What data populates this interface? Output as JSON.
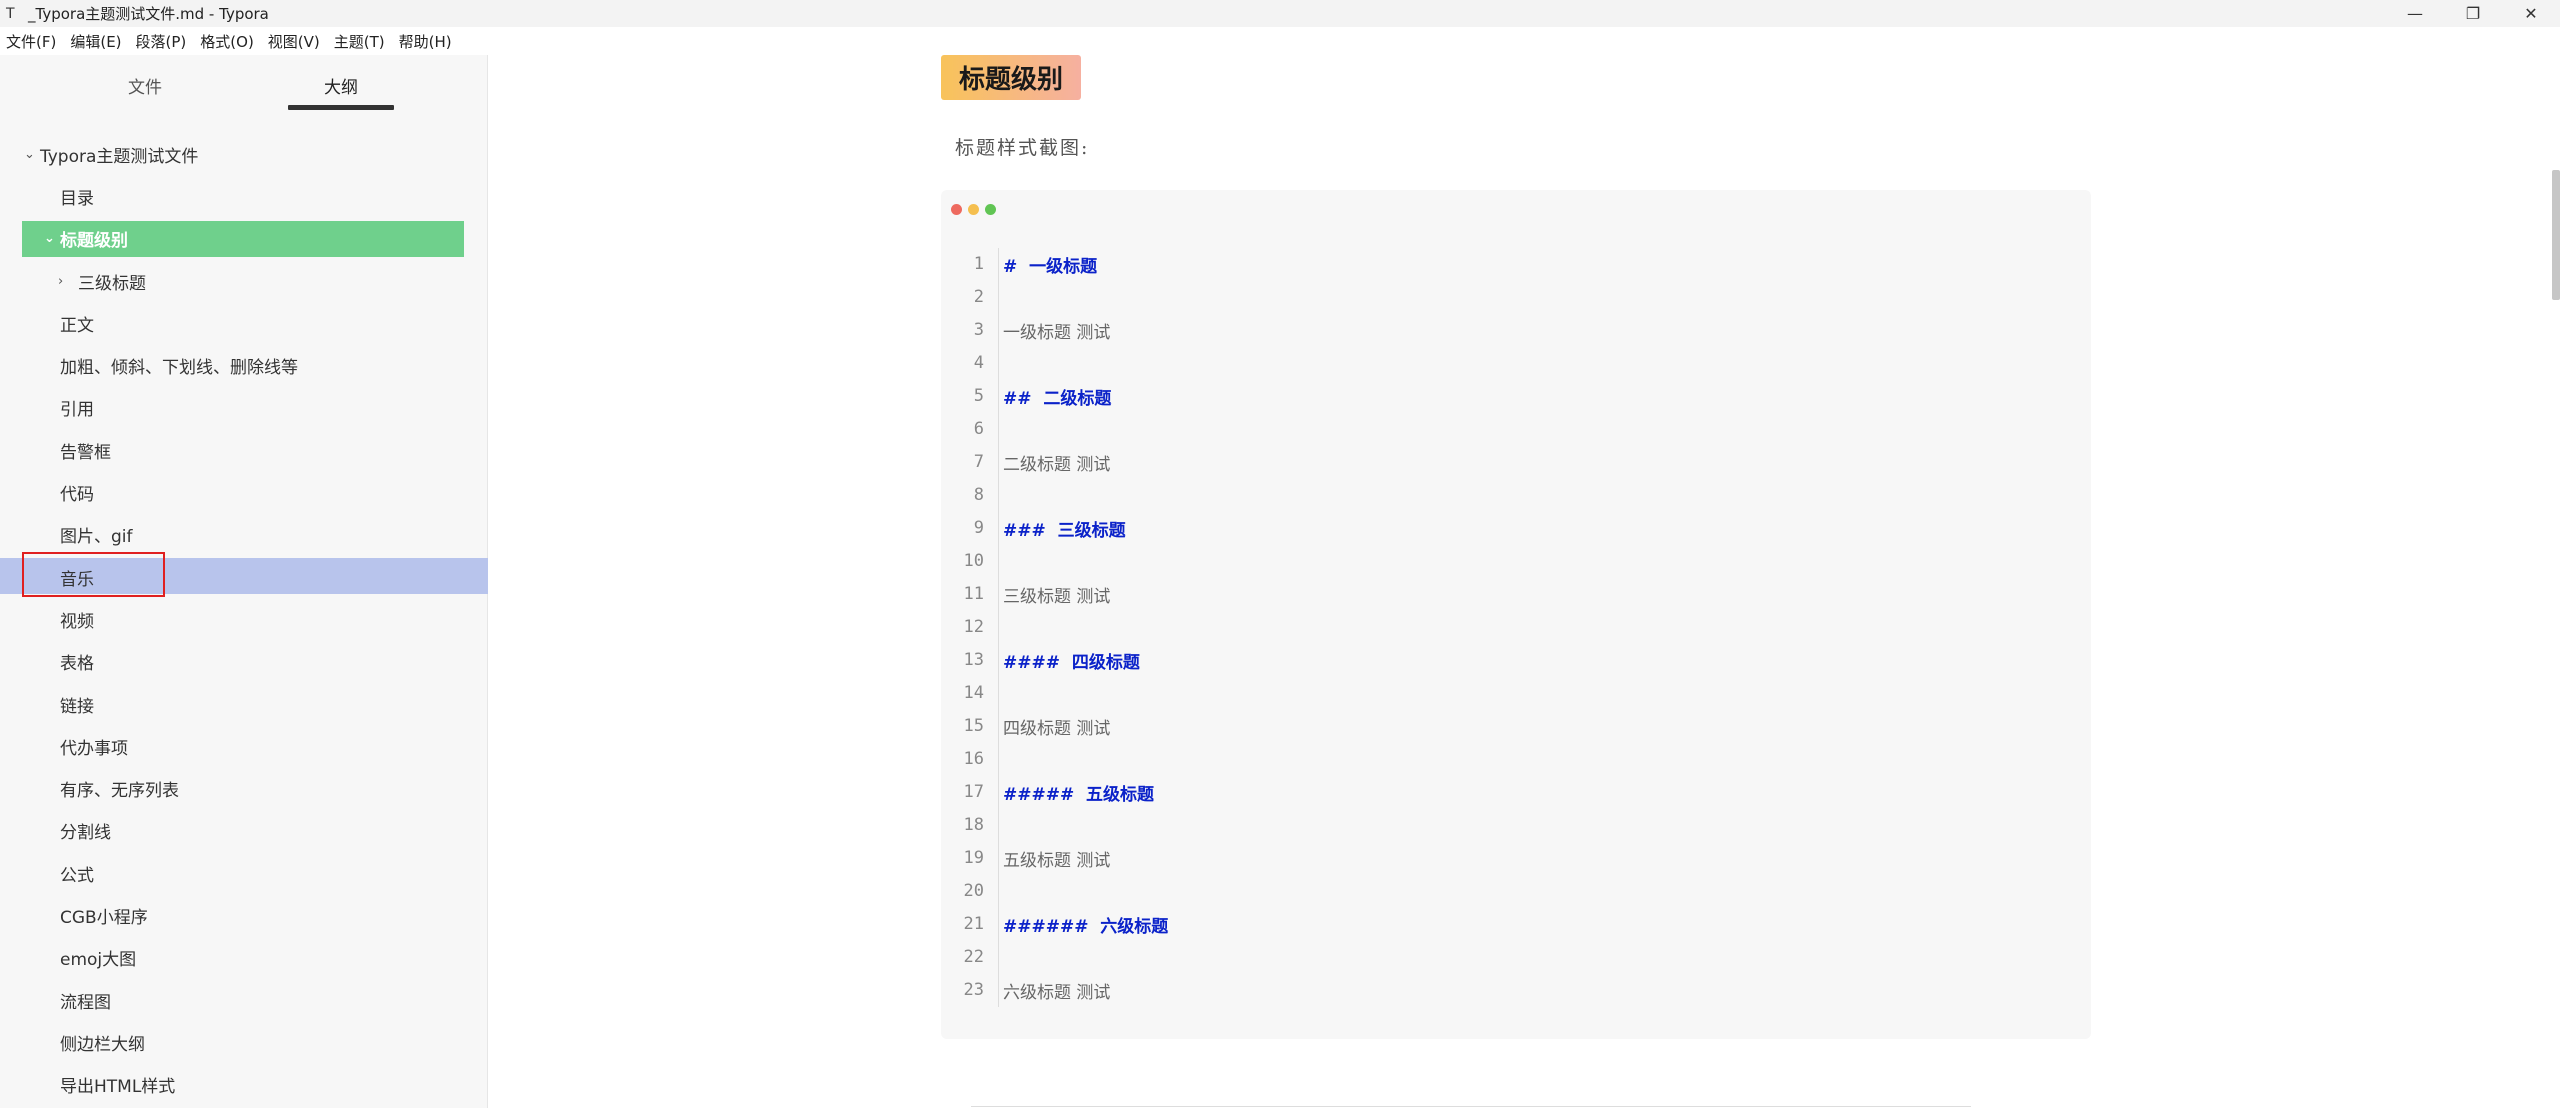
{
  "window": {
    "app_icon": "T",
    "title": "_Typora主题测试文件.md - Typora",
    "controls": {
      "minimize": "—",
      "maximize": "❐",
      "close": "✕"
    }
  },
  "menu": [
    "文件(F)",
    "编辑(E)",
    "段落(P)",
    "格式(O)",
    "视图(V)",
    "主题(T)",
    "帮助(H)"
  ],
  "sidebar": {
    "tabs": {
      "files": "文件",
      "outline": "大纲"
    },
    "root": "Typora主题测试文件",
    "items": [
      "目录",
      "标题级别",
      "三级标题",
      "正文",
      "加粗、倾斜、下划线、删除线等",
      "引用",
      "告警框",
      "代码",
      "图片、gif",
      "音乐",
      "视频",
      "表格",
      "链接",
      "代办事项",
      "有序、无序列表",
      "分割线",
      "公式",
      "CGB小程序",
      "emoj大图",
      "流程图",
      "侧边栏大纲",
      "导出HTML样式"
    ]
  },
  "main": {
    "heading": "标题级别",
    "paragraph": "标题样式截图:",
    "code_lines": [
      {
        "n": "1",
        "text": "#  一级标题",
        "kind": "heading"
      },
      {
        "n": "2",
        "text": "",
        "kind": "plain"
      },
      {
        "n": "3",
        "text": "一级标题 测试",
        "kind": "plain"
      },
      {
        "n": "4",
        "text": "",
        "kind": "plain"
      },
      {
        "n": "5",
        "text": "##  二级标题",
        "kind": "heading"
      },
      {
        "n": "6",
        "text": "",
        "kind": "plain"
      },
      {
        "n": "7",
        "text": "二级标题 测试",
        "kind": "plain"
      },
      {
        "n": "8",
        "text": "",
        "kind": "plain"
      },
      {
        "n": "9",
        "text": "###  三级标题",
        "kind": "heading"
      },
      {
        "n": "10",
        "text": "",
        "kind": "plain"
      },
      {
        "n": "11",
        "text": "三级标题 测试",
        "kind": "plain"
      },
      {
        "n": "12",
        "text": "",
        "kind": "plain"
      },
      {
        "n": "13",
        "text": "####  四级标题",
        "kind": "heading"
      },
      {
        "n": "14",
        "text": "",
        "kind": "plain"
      },
      {
        "n": "15",
        "text": "四级标题 测试",
        "kind": "plain"
      },
      {
        "n": "16",
        "text": "",
        "kind": "plain"
      },
      {
        "n": "17",
        "text": "#####  五级标题",
        "kind": "heading"
      },
      {
        "n": "18",
        "text": "",
        "kind": "plain"
      },
      {
        "n": "19",
        "text": "五级标题 测试",
        "kind": "plain"
      },
      {
        "n": "20",
        "text": "",
        "kind": "plain"
      },
      {
        "n": "21",
        "text": "######  六级标题",
        "kind": "heading"
      },
      {
        "n": "22",
        "text": "",
        "kind": "plain"
      },
      {
        "n": "23",
        "text": "六级标题 测试",
        "kind": "plain"
      }
    ]
  },
  "colors": {
    "outline_active": "#6fd08c",
    "outline_selected": "#b8c4ec",
    "highlight_box": "#e02020",
    "code_heading": "#0b22c9",
    "mac_red": "#ee6a5f",
    "mac_yellow": "#f5bf4f",
    "mac_green": "#61c554"
  }
}
